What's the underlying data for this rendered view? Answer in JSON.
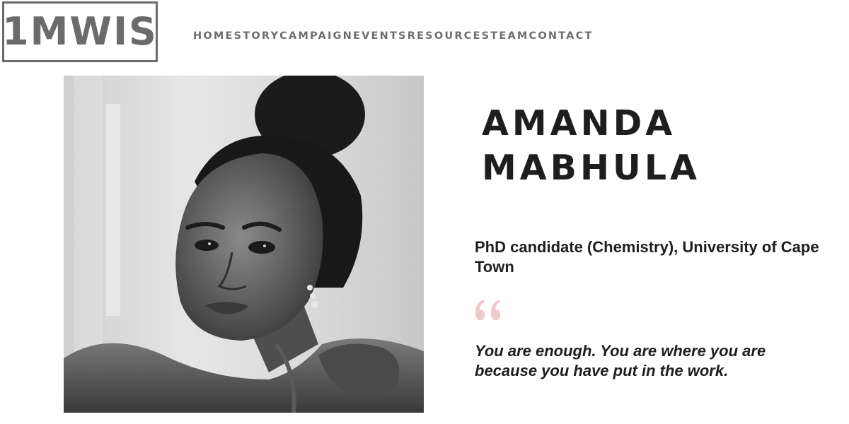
{
  "header": {
    "logo_text": "1MWIS",
    "nav": [
      {
        "label": "HOME"
      },
      {
        "label": "STORY"
      },
      {
        "label": "CAMPAIGN"
      },
      {
        "label": "EVENTS"
      },
      {
        "label": "RESOURCES"
      },
      {
        "label": "TEAM"
      },
      {
        "label": "CONTACT"
      }
    ]
  },
  "profile": {
    "first_name": "AMANDA",
    "last_name": "MABHULA",
    "role": "PhD candidate (Chemistry), University of Cape Town",
    "quote": "You are enough. You are where you are because you have put in the work."
  },
  "colors": {
    "logo": "#6b6b6b",
    "nav_text": "#6e6e6e",
    "heading_text": "#1e1e1e",
    "quote_mark": "#efc9cd"
  },
  "icons": {
    "quote_mark": "open-quote-icon"
  }
}
